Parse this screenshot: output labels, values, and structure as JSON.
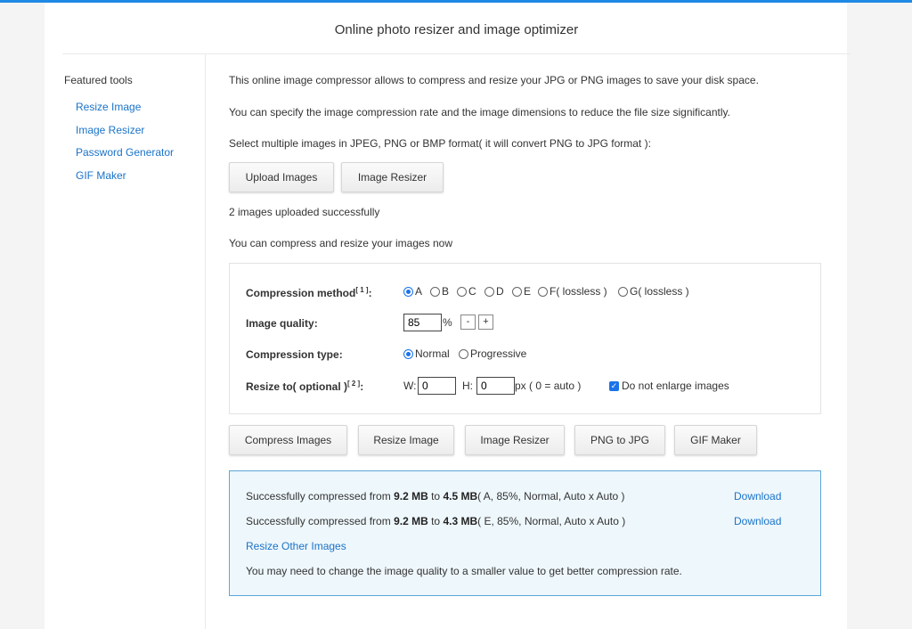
{
  "colors": {
    "accent": "#1e88e5",
    "link": "#1a73c8",
    "results_bg": "#eef7fc",
    "results_border": "#5ba6d6"
  },
  "page_title": "Online photo resizer and image optimizer",
  "sidebar": {
    "heading": "Featured tools",
    "links": [
      "Resize Image",
      "Image Resizer",
      "Password Generator",
      "GIF Maker"
    ]
  },
  "intro": {
    "line1": "This online image compressor allows to compress and resize your JPG or PNG images to save your disk space.",
    "line2": "You can specify the image compression rate and the image dimensions to reduce the file size significantly.",
    "line3": "Select multiple images in JPEG, PNG or BMP format( it will convert PNG to JPG format ):"
  },
  "upload_buttons": {
    "upload": "Upload Images",
    "resizer": "Image Resizer"
  },
  "status": {
    "uploaded": "2 images uploaded successfully",
    "ready": "You can compress and resize your images now"
  },
  "settings": {
    "method_label": "Compression method",
    "method_note": "[ 1 ]",
    "method_suffix": ":",
    "methods": [
      "A",
      "B",
      "C",
      "D",
      "E",
      "F( lossless )",
      "G( lossless )"
    ],
    "method_selected": "A",
    "quality_label": "Image quality:",
    "quality_value": "85",
    "quality_unit": "%",
    "quality_minus": "-",
    "quality_plus": "+",
    "type_label": "Compression type:",
    "type_options": [
      "Normal",
      "Progressive"
    ],
    "type_selected": "Normal",
    "resize_label": "Resize to( optional )",
    "resize_note": "[ 2 ]",
    "resize_suffix": ":",
    "w_label": "W:",
    "w_value": "0",
    "h_label": "H:",
    "h_value": "0",
    "px_note": "px ( 0 = auto )",
    "no_enlarge_label": "Do not enlarge images",
    "no_enlarge_checked": true
  },
  "action_buttons": [
    "Compress Images",
    "Resize Image",
    "Image Resizer",
    "PNG to JPG",
    "GIF Maker"
  ],
  "results": {
    "rows": [
      {
        "prefix": "Successfully compressed from ",
        "from": "9.2 MB",
        "mid": " to ",
        "to": "4.5 MB",
        "details": "( A, 85%, Normal, Auto x Auto )",
        "download": "Download"
      },
      {
        "prefix": "Successfully compressed from ",
        "from": "9.2 MB",
        "mid": " to ",
        "to": "4.3 MB",
        "details": "( E, 85%, Normal, Auto x Auto )",
        "download": "Download"
      }
    ],
    "resize_other": "Resize Other Images",
    "note": "You may need to change the image quality to a smaller value to get better compression rate."
  }
}
